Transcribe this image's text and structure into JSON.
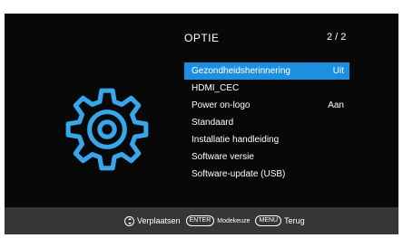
{
  "header": {
    "title": "OPTIE",
    "page": "2 / 2"
  },
  "menu": {
    "items": [
      {
        "label": "Gezondheidsherinnering",
        "value": "Uit",
        "selected": true
      },
      {
        "label": "HDMI_CEC",
        "value": ""
      },
      {
        "label": "Power on-logo",
        "value": "Aan"
      },
      {
        "label": "Standaard",
        "value": ""
      },
      {
        "label": "Installatie handleiding",
        "value": ""
      },
      {
        "label": "Software versie",
        "value": ""
      },
      {
        "label": "Software-update (USB)",
        "value": ""
      }
    ]
  },
  "footer": {
    "move_label": "Verplaatsen",
    "enter_key": "ENTER",
    "enter_label": "Modekeuze",
    "menu_key": "MENU",
    "menu_label": "Terug"
  },
  "icons": {
    "settings": "gear-icon",
    "navigate": "up-down-arrows-icon"
  },
  "colors": {
    "accent": "#1e8fe0",
    "background": "#080808",
    "footer": "#363636"
  }
}
